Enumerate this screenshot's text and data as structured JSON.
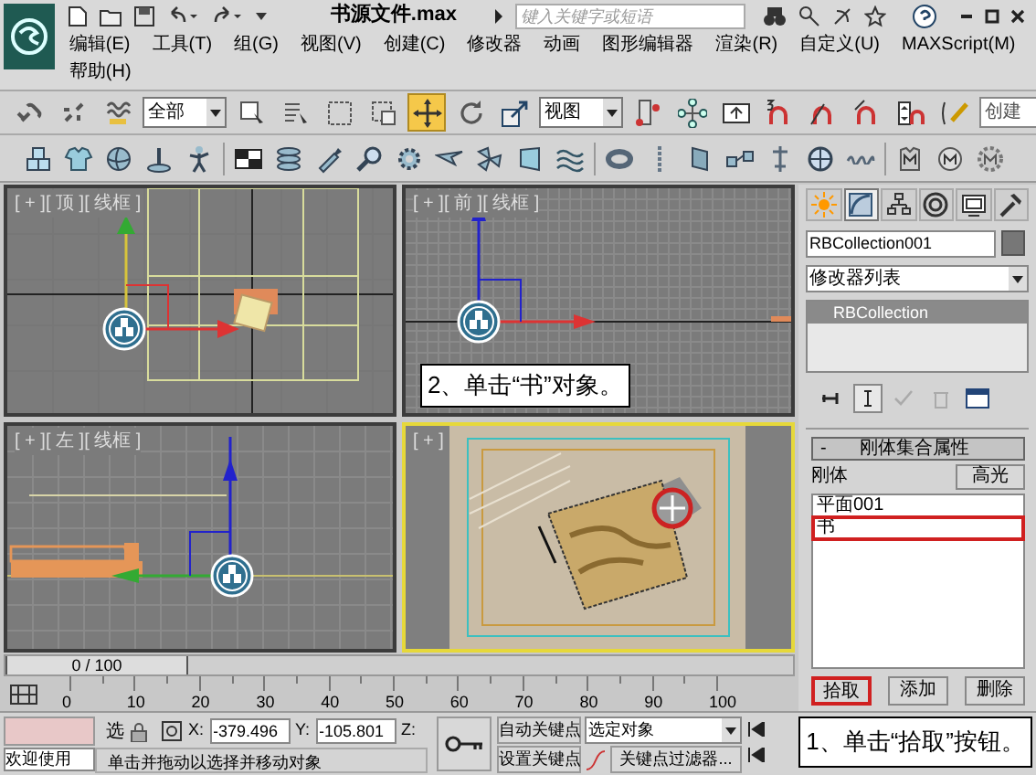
{
  "title_bar": {
    "title": "书源文件.max",
    "search": {
      "placeholder": "键入关键字或短语"
    }
  },
  "menu": [
    "编辑(E)",
    "工具(T)",
    "组(G)",
    "视图(V)",
    "创建(C)",
    "修改器",
    "动画",
    "图形编辑器",
    "渲染(R)",
    "自定义(U)",
    "MAXScript(M)",
    "帮助(H)"
  ],
  "main_toolbar": [
    {
      "kind": "link",
      "selected": false
    },
    {
      "kind": "unlink",
      "selected": false
    },
    {
      "kind": "bind",
      "selected": false
    },
    {
      "kind": "dropdown",
      "value": "全部"
    },
    {
      "kind": "select",
      "selected": false
    },
    {
      "kind": "select-by-name",
      "selected": false
    },
    {
      "kind": "region",
      "selected": false
    },
    {
      "kind": "crossing",
      "selected": false
    },
    {
      "kind": "move",
      "selected": true
    },
    {
      "kind": "rotate",
      "selected": false
    },
    {
      "kind": "scale",
      "selected": false
    },
    {
      "kind": "dropdown",
      "value": "视图"
    },
    {
      "kind": "pivot",
      "selected": false
    },
    {
      "kind": "manipulate",
      "selected": false
    },
    {
      "kind": "keyboard",
      "selected": false
    },
    {
      "kind": "snap",
      "selected": false
    },
    {
      "kind": "angle-snap",
      "selected": false
    },
    {
      "kind": "percent-snap",
      "selected": false
    },
    {
      "kind": "spinner-snap",
      "selected": false
    },
    {
      "kind": "edit-named",
      "selected": false
    },
    {
      "kind": "field",
      "value": "创建"
    }
  ],
  "reactor_toolbar": [
    {
      "kind": "cube"
    },
    {
      "kind": "shirt"
    },
    {
      "kind": "sphere"
    },
    {
      "kind": "pin"
    },
    {
      "kind": "figure"
    },
    {
      "kind": "separator"
    },
    {
      "kind": "checker"
    },
    {
      "kind": "disks"
    },
    {
      "kind": "bottle"
    },
    {
      "kind": "magnifier"
    },
    {
      "kind": "gear"
    },
    {
      "kind": "plane"
    },
    {
      "kind": "fan"
    },
    {
      "kind": "cloth"
    },
    {
      "kind": "wave"
    },
    {
      "kind": "separator"
    },
    {
      "kind": "torus"
    },
    {
      "kind": "rope"
    },
    {
      "kind": "sheet"
    },
    {
      "kind": "dumbbell"
    },
    {
      "kind": "hinge"
    },
    {
      "kind": "wheel"
    },
    {
      "kind": "spring"
    },
    {
      "kind": "separator"
    },
    {
      "kind": "m-badge"
    },
    {
      "kind": "m-circle"
    },
    {
      "kind": "m-gear"
    }
  ],
  "viewports": [
    {
      "kind": "top",
      "label": "[ + ][ 顶 ][ 线框 ]",
      "active": false
    },
    {
      "kind": "front",
      "label": "[ + ][ 前 ][ 线框 ]",
      "active": false
    },
    {
      "kind": "left",
      "label": "[ + ][ 左 ][ 线框 ]",
      "active": false
    },
    {
      "kind": "perspective",
      "label": "[ + ]",
      "active": true
    }
  ],
  "command_panel": {
    "tabs": [
      {
        "kind": "create",
        "selected": false
      },
      {
        "kind": "modify",
        "selected": true
      },
      {
        "kind": "hierarchy",
        "selected": false
      },
      {
        "kind": "motion",
        "selected": false
      },
      {
        "kind": "display",
        "selected": false
      },
      {
        "kind": "utilities",
        "selected": false
      }
    ],
    "object_name": "RBCollection001",
    "modifier_list": "修改器列表",
    "stack": [
      {
        "label": "RBCollection",
        "selected": true
      }
    ],
    "stack_tools": [
      {
        "kind": "pin",
        "selected": false
      },
      {
        "kind": "show-end",
        "selected": true
      },
      {
        "kind": "make-unique",
        "selected": false
      },
      {
        "kind": "remove",
        "selected": false
      },
      {
        "kind": "configure",
        "selected": false
      }
    ],
    "rollout": {
      "collapse": "-",
      "title": "刚体集合属性",
      "label": "刚体",
      "highlight_button": "高光",
      "items": [
        {
          "label": "平面001",
          "selected": false,
          "annotated": false
        },
        {
          "label": "书",
          "selected": false,
          "annotated": true
        }
      ],
      "buttons": [
        {
          "label": "拾取",
          "annotated": true
        },
        {
          "label": "添加",
          "annotated": false
        },
        {
          "label": "删除",
          "annotated": false
        }
      ]
    }
  },
  "time_slider": {
    "label": "0 / 100",
    "level": 0
  },
  "track_bar": {
    "ticks": [
      "0",
      "10",
      "20",
      "30",
      "40",
      "50",
      "60",
      "70",
      "80",
      "90",
      "100"
    ]
  },
  "status_bar": {
    "welcome": "欢迎使用",
    "selection_label": "选",
    "coords": [
      {
        "axis": "X:",
        "value": "-379.496"
      },
      {
        "axis": "Y:",
        "value": "-105.801"
      },
      {
        "axis": "Z:"
      }
    ],
    "prompt": "单击并拖动以选择并移动对象",
    "auto_key": "自动关键点",
    "set_key": "设置关键点",
    "key_mode": "选定对象",
    "key_filters": "关键点过滤器..."
  },
  "annotations": [
    {
      "kind": "viewport",
      "text": "2、单击“书”对象。"
    },
    {
      "kind": "status",
      "text": "1、单击“拾取”按钮。"
    }
  ]
}
